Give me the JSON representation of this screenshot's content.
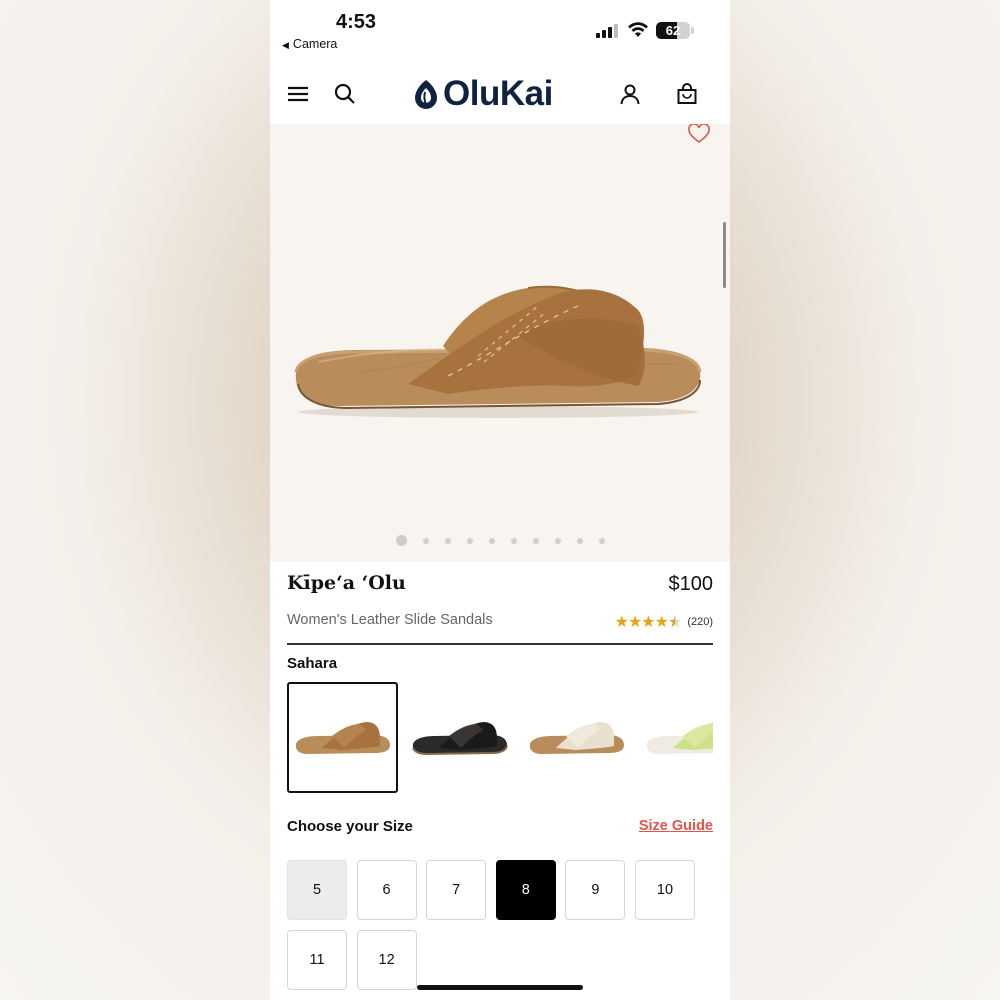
{
  "status_bar": {
    "time": "4:53",
    "back_app": "Camera",
    "battery": "62",
    "battery_level": 0.62
  },
  "header": {
    "brand": "OluKai",
    "icons": [
      "menu-icon",
      "search-icon",
      "account-icon",
      "bag-icon"
    ]
  },
  "gallery": {
    "image_count": 10,
    "active_index": 0
  },
  "product": {
    "name": "Kīpeʻa ʻOlu",
    "price": "$100",
    "subtitle": "Women's Leather Slide Sandals",
    "rating": 4.5,
    "review_count": "(220)"
  },
  "colors": {
    "selected_label": "Sahara",
    "swatches": [
      "sahara",
      "black",
      "cream",
      "lime"
    ]
  },
  "sizes": {
    "label": "Choose your Size",
    "guide_label": "Size Guide",
    "options": [
      "5",
      "6",
      "7",
      "8",
      "9",
      "10",
      "11",
      "12"
    ],
    "selected": "8",
    "unavailable": [
      "5"
    ]
  },
  "colors_theme": {
    "brand_navy": "#0f2341",
    "accent_red": "#e05547",
    "star_gold": "#e6a511",
    "hero_bg": "#f8f4ef"
  }
}
